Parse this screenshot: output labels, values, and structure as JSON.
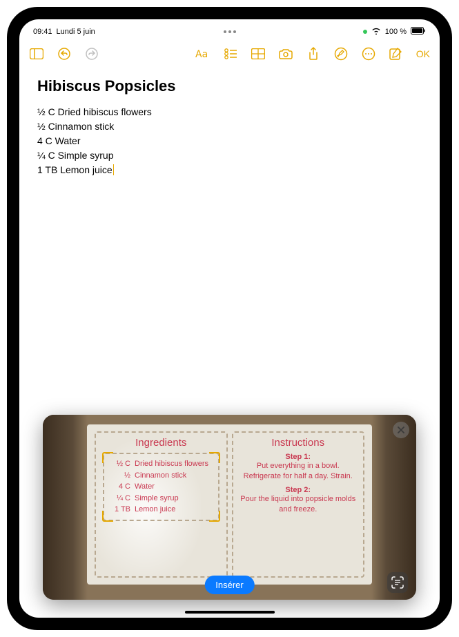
{
  "status": {
    "time": "09:41",
    "date": "Lundi 5 juin",
    "battery": "100 %",
    "green_dot": true
  },
  "toolbar": {
    "done": "OK"
  },
  "note": {
    "title": "Hibiscus Popsicles",
    "body": "½ C  Dried hibiscus flowers\n½ Cinnamon stick\n4 C Water\n¼ C Simple syrup\n1 TB Lemon juice"
  },
  "live_text": {
    "insert_label": "Insérer",
    "card": {
      "ingredients_heading": "Ingredients",
      "ingredients": [
        {
          "amt": "½  C",
          "name": "Dried hibiscus flowers"
        },
        {
          "amt": "½",
          "name": "Cinnamon stick"
        },
        {
          "amt": "4  C",
          "name": "Water"
        },
        {
          "amt": "¼ C",
          "name": "Simple syrup"
        },
        {
          "amt": "1 TB",
          "name": "Lemon juice"
        }
      ],
      "instructions_heading": "Instructions",
      "steps": [
        {
          "label": "Step 1:",
          "text": "Put everything in a bowl. Refrigerate for half a day. Strain."
        },
        {
          "label": "Step 2:",
          "text": "Pour the liquid into popsicle molds and freeze."
        }
      ]
    }
  }
}
